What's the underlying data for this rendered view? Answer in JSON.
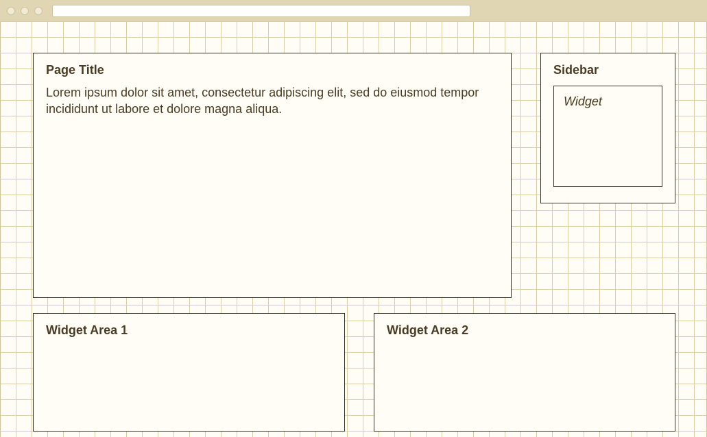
{
  "main": {
    "title": "Page Title",
    "body": "Lorem ipsum dolor sit amet, consectetur adipiscing elit, sed do eiusmod tempor incididunt ut labore et dolore magna aliqua."
  },
  "sidebar": {
    "title": "Sidebar",
    "widget_label": "Widget"
  },
  "widget_area_1": {
    "title": "Widget Area 1"
  },
  "widget_area_2": {
    "title": "Widget Area 2"
  }
}
